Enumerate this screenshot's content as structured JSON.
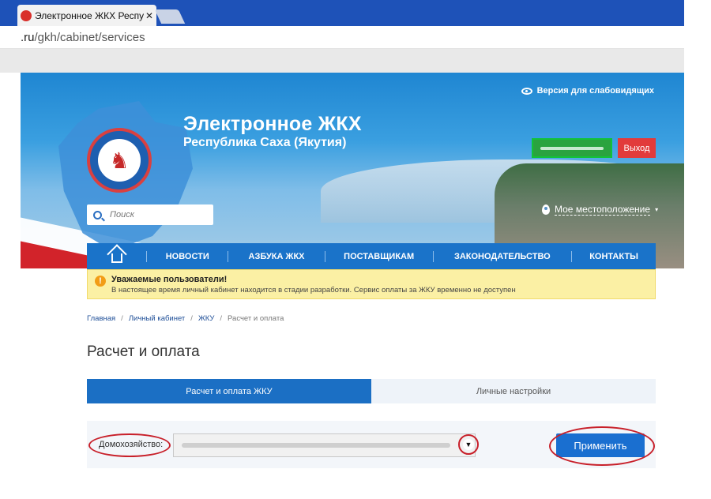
{
  "browser": {
    "tab_title": "Электронное ЖКХ Респуб",
    "tab_close": "✕",
    "url_domain": ".ru",
    "url_path": "/gkh/cabinet/services"
  },
  "header": {
    "title": "Электронное ЖКХ",
    "subtitle": "Республика Саха (Якутия)",
    "accessibility_link": "Версия для слабовидящих",
    "logout_label": "Выход",
    "location_label": "Мое местоположение",
    "search_placeholder": "Поиск"
  },
  "nav": {
    "items": [
      "НОВОСТИ",
      "АЗБУКА ЖКХ",
      "ПОСТАВЩИКАМ",
      "ЗАКОНОДАТЕЛЬСТВО",
      "КОНТАКТЫ"
    ]
  },
  "notice": {
    "icon": "!",
    "title": "Уважаемые пользователи!",
    "text": "В настоящее время личный кабинет находится в стадии разработки. Сервис оплаты за ЖКУ временно не доступен"
  },
  "breadcrumb": {
    "items": [
      "Главная",
      "Личный кабинет",
      "ЖКУ"
    ],
    "separator": "/",
    "current": "Расчет и оплата"
  },
  "page": {
    "title": "Расчет и оплата"
  },
  "tabs": [
    {
      "label": "Расчет и оплата ЖКУ",
      "active": true
    },
    {
      "label": "Личные настройки",
      "active": false
    }
  ],
  "form": {
    "household_label": "Домохозяйство:",
    "apply_label": "Применить"
  },
  "colors": {
    "nav": "#1a73c9",
    "logout": "#e23b3b",
    "notice_bg": "#fbf0a4",
    "annotation": "#c8202a"
  }
}
